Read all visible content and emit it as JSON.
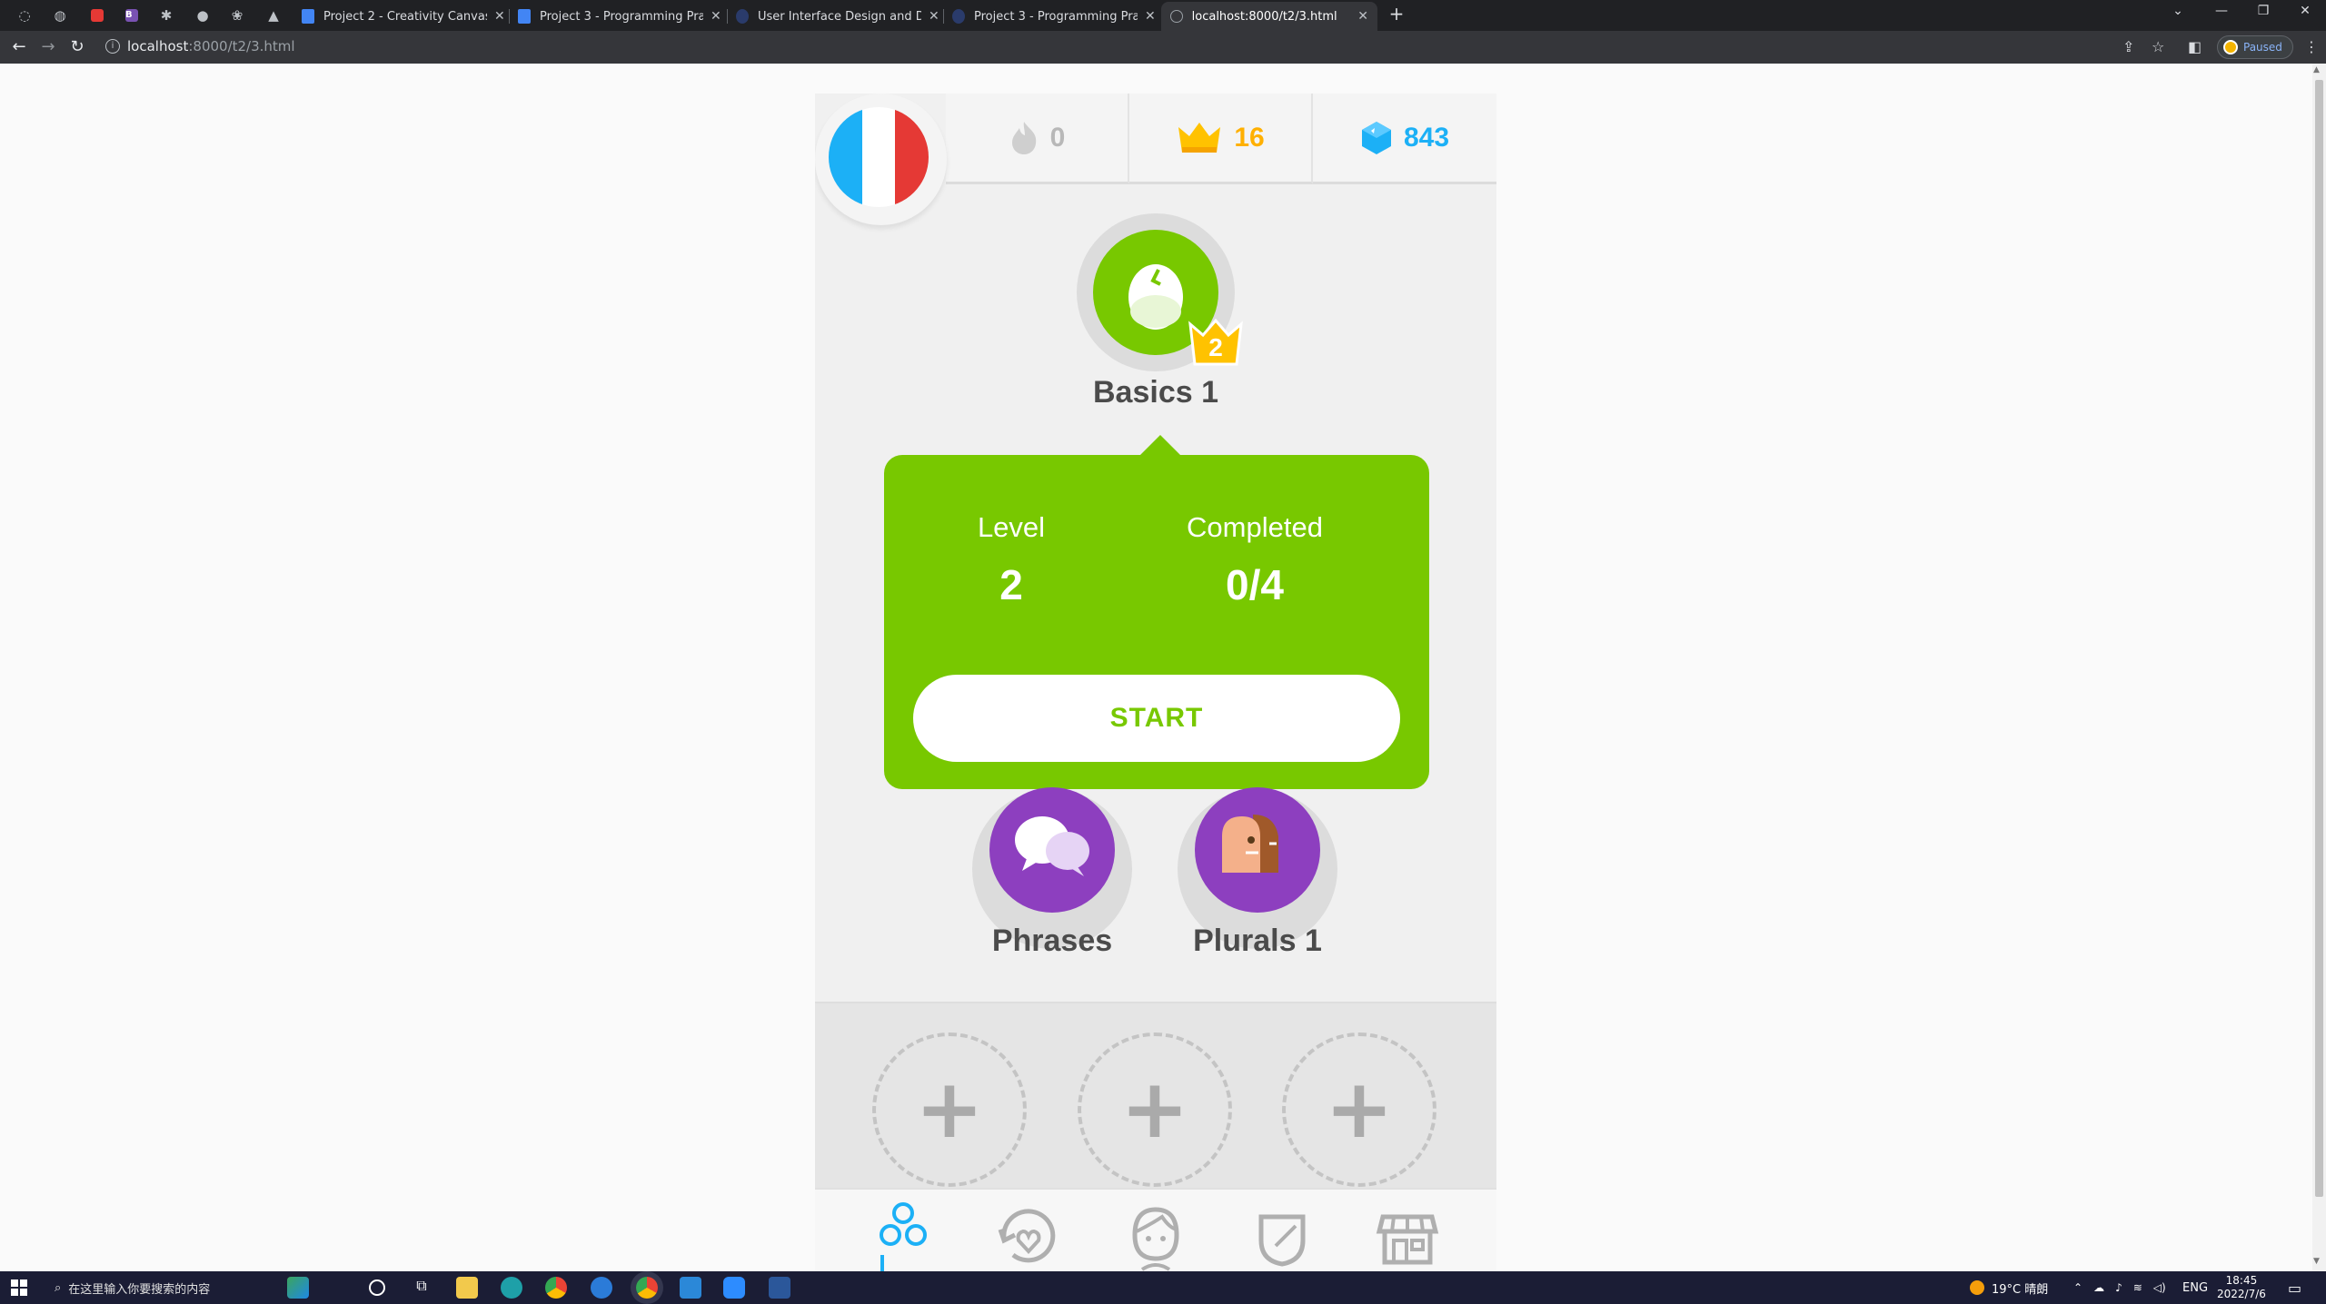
{
  "browser": {
    "tabs": [
      {
        "title": "Project 2 - Creativity Canvas - (",
        "active": false
      },
      {
        "title": "Project 3 - Programming Practi",
        "active": false
      },
      {
        "title": "User Interface Design and Dev",
        "active": false
      },
      {
        "title": "Project 3 - Programming Practi",
        "active": false
      },
      {
        "title": "localhost:8000/t2/3.html",
        "active": true
      }
    ],
    "url_host": "localhost",
    "url_path": ":8000/t2/3.html",
    "paused_label": "Paused"
  },
  "stats": {
    "streak": "0",
    "crowns": "16",
    "gems": "843"
  },
  "skills": {
    "basics": {
      "name": "Basics 1",
      "crown_level": "2"
    },
    "phrases": {
      "name": "Phrases"
    },
    "plurals": {
      "name": "Plurals 1"
    }
  },
  "popup": {
    "level_label": "Level",
    "level_value": "2",
    "completed_label": "Completed",
    "completed_value": "0/4",
    "start_label": "START"
  },
  "bottom_nav": [
    "learn",
    "practice",
    "profile",
    "leagues",
    "shop"
  ],
  "taskbar": {
    "search_placeholder": "在这里输入你要搜索的内容",
    "weather": "19°C 晴朗",
    "lang": "ENG",
    "time": "18:45",
    "date": "2022/7/6"
  },
  "colors": {
    "green": "#78c800",
    "purple": "#8d3fbf",
    "gold": "#ffb000",
    "blue": "#1cb0f6"
  }
}
